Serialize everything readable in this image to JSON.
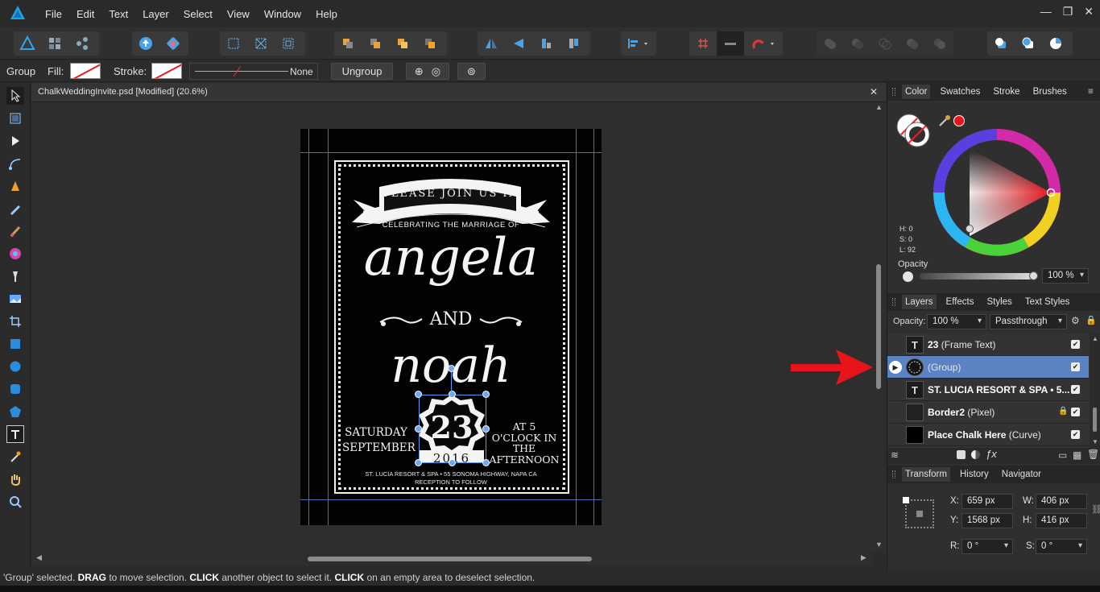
{
  "menu": [
    "File",
    "Edit",
    "Text",
    "Layer",
    "Select",
    "View",
    "Window",
    "Help"
  ],
  "window_controls": [
    "—",
    "❐",
    "✕"
  ],
  "context": {
    "group_label": "Group",
    "fill_label": "Fill:",
    "stroke_label": "Stroke:",
    "stroke_none": "None",
    "ungroup": "Ungroup"
  },
  "document": {
    "tab_title": "ChalkWeddingInvite.psd [Modified] (20.6%)",
    "close": "✕"
  },
  "invite": {
    "banner": "PLEASE JOIN US IN",
    "subtitle": "CELEBRATING THE MARRIAGE OF",
    "name1": "angela",
    "and": "AND",
    "name2": "noah",
    "left_text": "SATURDAY SEPTEMBER",
    "day": "23",
    "year": "2016",
    "right_text": "AT 5 O'CLOCK IN THE AFTERNOON",
    "venue": "ST. LUCIA RESORT & SPA • 55 SONOMA HIGHWAY, NAPA CA",
    "reception": "RECEPTION TO FOLLOW"
  },
  "color_panel": {
    "tabs": [
      "Color",
      "Swatches",
      "Stroke",
      "Brushes"
    ],
    "h": "H: 0",
    "s": "S: 0",
    "l": "L: 92",
    "opacity_label": "Opacity",
    "opacity_value": "100 %",
    "colors": {
      "accent_red": "#e8141c",
      "selection_blue": "#5b83c4"
    }
  },
  "layers_panel": {
    "tabs": [
      "Layers",
      "Effects",
      "Styles",
      "Text Styles"
    ],
    "opacity_label": "Opacity:",
    "opacity_value": "100 %",
    "blend_mode": "Passthrough",
    "layers": [
      {
        "name": "23",
        "type": "(Frame Text)",
        "thumb": "T"
      },
      {
        "name": "",
        "type": "(Group)",
        "thumb": ""
      },
      {
        "name": "ST. LUCIA RESORT & SPA • 5...",
        "type": "",
        "thumb": "T"
      },
      {
        "name": "Border2",
        "type": "(Pixel)",
        "thumb": ""
      },
      {
        "name": "Place Chalk Here",
        "type": "(Curve)",
        "thumb": ""
      }
    ]
  },
  "transform_panel": {
    "tabs": [
      "Transform",
      "History",
      "Navigator"
    ],
    "x_label": "X:",
    "x": "659 px",
    "y_label": "Y:",
    "y": "1568 px",
    "w_label": "W:",
    "w": "406 px",
    "h_label": "H:",
    "h": "416 px",
    "r_label": "R:",
    "r": "0 °",
    "s_label": "S:",
    "s": "0 °"
  },
  "status": {
    "q": "'Group' selected. ",
    "drag": "DRAG",
    "t1": " to move selection. ",
    "click": "CLICK",
    "t2": " another object to select it. ",
    "click2": "CLICK",
    "t3": " on an empty area to deselect selection."
  }
}
